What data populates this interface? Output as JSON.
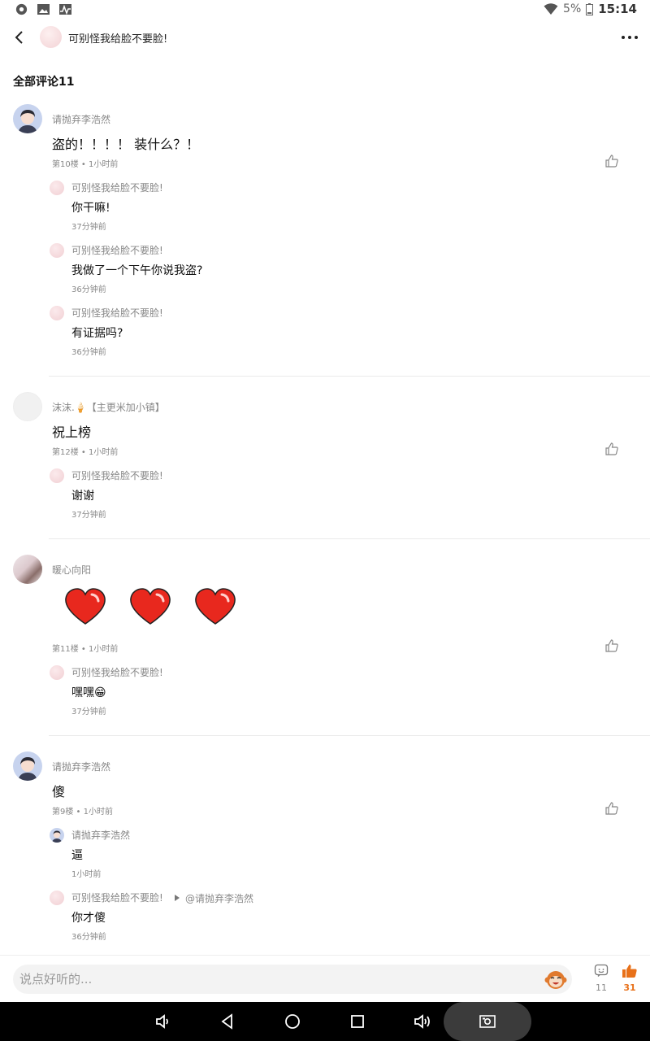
{
  "status_bar": {
    "battery": "5%",
    "time": "15:14"
  },
  "header": {
    "title": "可别怪我给脸不要脸!"
  },
  "section": {
    "title": "全部评论11"
  },
  "comments": [
    {
      "name": "请抛弃李浩然",
      "text": "盗的！！！！ 装什么？！",
      "meta": "第10楼 • 1小时前",
      "replies": [
        {
          "name": "可别怪我给脸不要脸!",
          "text": "你干嘛!",
          "time": "37分钟前"
        },
        {
          "name": "可别怪我给脸不要脸!",
          "text": "我做了一个下午你说我盗?",
          "time": "36分钟前"
        },
        {
          "name": "可别怪我给脸不要脸!",
          "text": "有证据吗?",
          "time": "36分钟前"
        }
      ]
    },
    {
      "name": "沫沫.🍦【主更米加小镇】",
      "text": "祝上榜",
      "meta": "第12楼 • 1小时前",
      "replies": [
        {
          "name": "可别怪我给脸不要脸!",
          "text": "谢谢",
          "time": "37分钟前"
        }
      ]
    },
    {
      "name": "暖心向阳",
      "meta": "第11楼 • 1小时前",
      "replies": [
        {
          "name": "可别怪我给脸不要脸!",
          "text": "嘿嘿😁",
          "time": "37分钟前"
        }
      ]
    },
    {
      "name": "请抛弃李浩然",
      "text": "傻",
      "meta": "第9楼 • 1小时前",
      "replies": [
        {
          "name": "请抛弃李浩然",
          "text": "逼",
          "time": "1小时前"
        },
        {
          "name": "可别怪我给脸不要脸!",
          "at": "@请抛弃李浩然",
          "text": "你才傻",
          "time": "36分钟前"
        }
      ]
    }
  ],
  "bottom_bar": {
    "placeholder": "说点好听的...",
    "comment_count": "11",
    "like_count": "31",
    "accent_color": "#e8711a"
  },
  "icons": [
    "back-icon",
    "more-icon",
    "like-icon",
    "heart-sticker",
    "monkey-emoji-icon",
    "comment-icon",
    "thumbs-up-icon"
  ]
}
